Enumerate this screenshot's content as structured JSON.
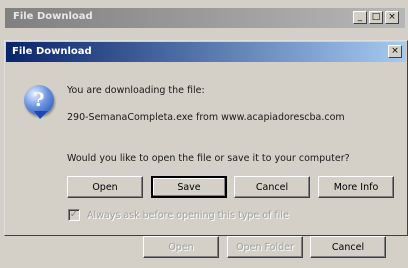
{
  "background_window": {
    "title": "File Download",
    "controls": {
      "minimize": "_",
      "maximize": "□",
      "close": "×"
    },
    "buttons": {
      "open": "Open",
      "open_folder": "Open Folder",
      "cancel": "Cancel"
    }
  },
  "dialog": {
    "title": "File Download",
    "close": "×",
    "icon": "question-icon",
    "icon_glyph": "?",
    "message": "You are downloading the file:",
    "file_line": "290-SemanaCompleta.exe from www.acapiadorescba.com",
    "prompt": "Would you like to open the file or save it to your computer?",
    "buttons": {
      "open": "Open",
      "save": "Save",
      "cancel": "Cancel",
      "more_info": "More Info"
    },
    "checkbox": {
      "checked": true,
      "mark": "✓",
      "label": "Always ask before opening this type of file"
    }
  }
}
